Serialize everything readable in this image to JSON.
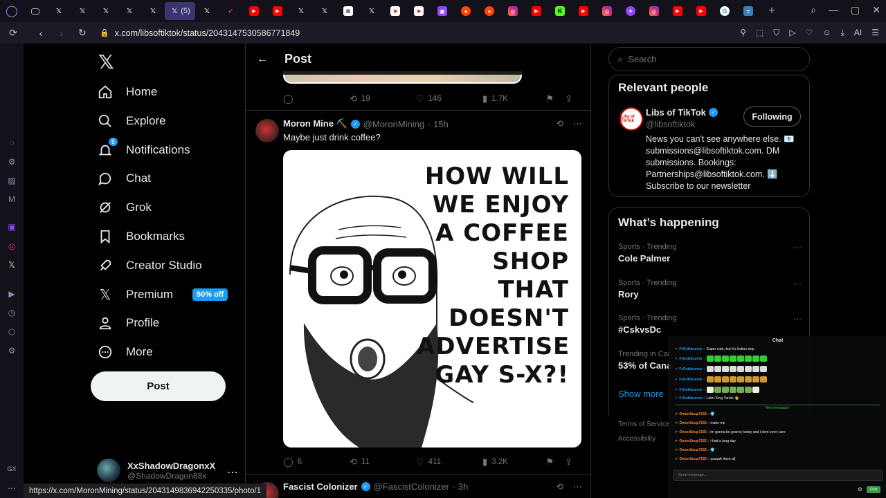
{
  "browser": {
    "active_tab_count": "(5)",
    "url": "x.com/libsoftiktok/status/2043147530586771849",
    "ai_label": "AI",
    "gx_label": "GX",
    "status_url": "https://x.com/MoronMining/status/2043149836942250335/photo/1"
  },
  "nav": {
    "items": [
      {
        "label": "Home",
        "icon": "home-icon"
      },
      {
        "label": "Explore",
        "icon": "search-icon"
      },
      {
        "label": "Notifications",
        "icon": "bell-icon",
        "badge": "5"
      },
      {
        "label": "Chat",
        "icon": "chat-icon"
      },
      {
        "label": "Grok",
        "icon": "grok-icon"
      },
      {
        "label": "Bookmarks",
        "icon": "bookmark-icon"
      },
      {
        "label": "Creator Studio",
        "icon": "rocket-icon"
      },
      {
        "label": "Premium",
        "icon": "x-icon",
        "promo": "50% off"
      },
      {
        "label": "Profile",
        "icon": "person-icon"
      },
      {
        "label": "More",
        "icon": "more-circle-icon"
      }
    ],
    "post_button": "Post",
    "account": {
      "name": "XxShadowDragonxX",
      "handle": "@ShadowDragon88x"
    }
  },
  "main": {
    "header_title": "Post",
    "prev_actions": {
      "replies": "",
      "reposts": "19",
      "likes": "146",
      "views": "1.7K"
    },
    "tweet": {
      "name": "Moron Mine ⛏️",
      "handle": "@MoronMining",
      "time": "· 15h",
      "text": "Maybe just drink coffee?",
      "image_text": [
        "HOW WILL",
        "WE ENJOY",
        "A COFFEE",
        "SHOP THAT",
        "DOESN'T",
        "ADVERTISE",
        "GAY S-X?!"
      ],
      "actions": {
        "replies": "6",
        "reposts": "11",
        "likes": "411",
        "views": "3.2K"
      }
    },
    "next_tweet": {
      "name": "Fascist Colonizer",
      "handle": "@FascistColonizer",
      "time": "· 3h"
    }
  },
  "right": {
    "search_placeholder": "Search",
    "relevant": {
      "title": "Relevant people",
      "name": "Libs of TikTok",
      "handle": "@libsoftiktok",
      "follow_label": "Following",
      "bio": "News you can't see anywhere else. 📧 submissions@libsoftiktok.com. DM submissions. Bookings: Partnerships@libsoftiktok.com. ⬇️ Subscribe to our newsletter",
      "avatar_text": "Libs of TikTok"
    },
    "happening": {
      "title": "What’s happening",
      "trends": [
        {
          "meta": "Sports · Trending",
          "name": "Cole Palmer"
        },
        {
          "meta": "Sports · Trending",
          "name": "Rory"
        },
        {
          "meta": "Sports · Trending",
          "name": "#CskvsDc"
        },
        {
          "meta": "Trending in Can",
          "name": "53% of Cana"
        }
      ],
      "show_more": "Show more"
    },
    "footer": {
      "terms": "Terms of Service",
      "accessibility": "Accessibility"
    }
  },
  "chat": {
    "title": "Chat",
    "lines": [
      {
        "user": "FrGothburner",
        "msg": "Super cute, but it's Indian slop"
      },
      {
        "user": "FrGothburner",
        "msg": ""
      },
      {
        "user": "FrGothburner",
        "msg": ""
      },
      {
        "user": "FrGothburner",
        "msg": ""
      },
      {
        "user": "FrGothburner",
        "msg": ""
      },
      {
        "user": "FrGothburner",
        "msg": "Later King Tardio 👋"
      }
    ],
    "new_messages": "New messages",
    "lines2": [
      {
        "user": "OnionSoup7155",
        "msg": "🌍"
      },
      {
        "user": "OnionSoup7155",
        "msg": "make me"
      },
      {
        "user": "OnionSoup7155",
        "msg": "im gonna be granny today and i dont even care"
      },
      {
        "user": "OnionSoup7155",
        "msg": "i had a long day"
      },
      {
        "user": "OnionSoup7155",
        "msg": "🌍"
      },
      {
        "user": "OnionSoup7155",
        "msg": "assault them all"
      }
    ],
    "input_placeholder": "Send message...",
    "send_label": "Chat"
  }
}
